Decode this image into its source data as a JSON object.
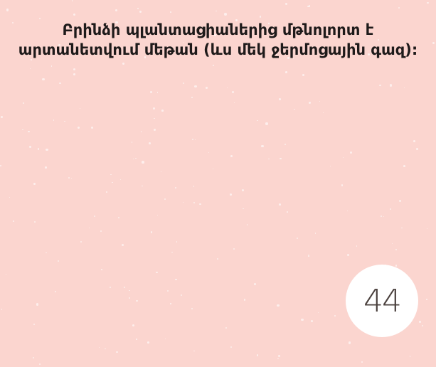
{
  "slide": {
    "text": "Բրինձի պլանտացիաներից մթնոլորտ է արտանետվում մեթան (ևս մեկ ջերմոցային գազ):",
    "page_number": "44",
    "background_color": "#fbd5cf",
    "badge_color": "#ffffff"
  }
}
